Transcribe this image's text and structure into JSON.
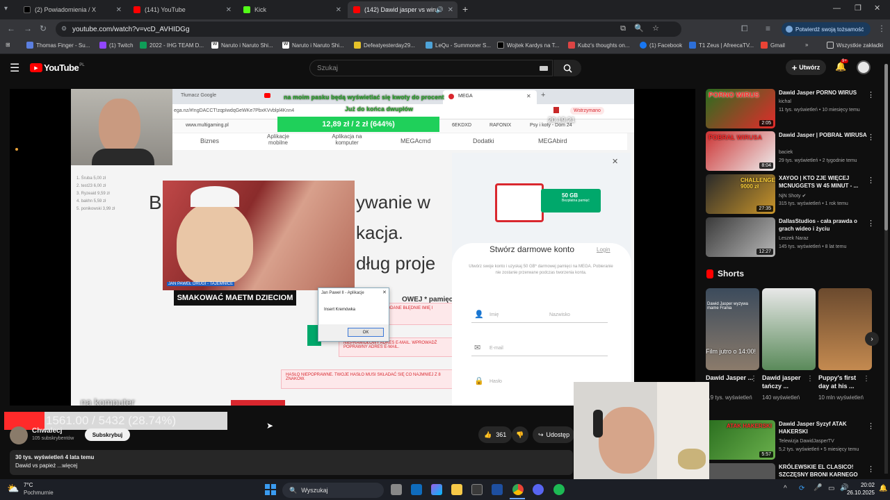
{
  "tabs": [
    {
      "label": "(2) Powiadomienia / X",
      "icon": "x-logo-icon"
    },
    {
      "label": "(141) YouTube",
      "icon": "youtube-icon"
    },
    {
      "label": "Kick",
      "icon": "kick-icon"
    },
    {
      "label": "(142) Dawid jasper vs wiru",
      "icon": "youtube-icon"
    }
  ],
  "address": {
    "url": "youtube.com/watch?v=vcD_AVHIDGg",
    "identity_button": "Potwierdź swoją tożsamość"
  },
  "bookmarks": [
    "Thomas Finger - Su...",
    "(1) Twitch",
    "2022 - IHG TEAM D...",
    "Naruto i Naruto Shi...",
    "Naruto i Naruto Shi...",
    "Defeatyesterday29...",
    "LeQu - Summoner S...",
    "Wojtek Kardys na T...",
    "Kubz's thoughts on...",
    "(1) Facebook",
    "T1 Zeus | AfreecaTV...",
    "Gmail",
    "Wszystkie zakładki"
  ],
  "yt": {
    "logo": "YouTube",
    "logo_region": "PL",
    "search_placeholder": "Szukaj",
    "create_label": "Utwórz",
    "notif_count": "9+"
  },
  "video_overlay": {
    "mega_tab": "MEGA",
    "google_tab": "Tłumacz Google",
    "mega_url": "ega.nz/#!ngDACCT!zqpIwdqGeWKe7PbxKVvblpl4Knn4",
    "donation_banner": "12,89 zł / 2 zł (644%)",
    "stream_text_top": "na moim pasku będą wyświetlać się kwoty do procent",
    "stream_text_top2": "Już do końca dwupłów",
    "bookmark_site": "www.multigaming.pl",
    "bookmark_right1": "6EKDXD",
    "bookmark_right2": "RAFONIX",
    "bookmark_right3": "Psy i koty - Dom 24",
    "timer": "20:19:21",
    "nav": [
      "Biznes",
      "Aplikacje mobilne",
      "Aplikacja na komputer",
      "MEGAcmd",
      "Dodatki",
      "MEGAbird"
    ],
    "headline_left": "B",
    "headline_right1": "ywanie w",
    "headline_right2": "kacja.",
    "headline_right3": "dług proje",
    "stats": [
      "1. Śruba 5,00 zł",
      "2. test23 6,00 zł",
      "3. Ryzeaid 9,59 zł",
      "4. bakhn 5,59 zł",
      "5. ponikowski 3,99 zł"
    ],
    "pope_caption": "JAN PAWEŁ DRUGI - TAJEMNICE",
    "pope_subtitle": "SMAKOWAĆ MAETM DZIECIOM",
    "dialog_title": "Jan Paweł II - Aplikacje",
    "dialog_text": "Insert Kremówka",
    "dialog_ok": "OK",
    "signup_title": "Stwórz darmowe konto",
    "signup_login": "Login",
    "signup_desc": "Utwórz swoje konto i uzyskaj 50 GB* darmowej pamięci na MEGA. Pobieranie nie zostanie przerwane podczas tworzenia konta.",
    "storage_badge": "50 GB",
    "storage_sub": "Bezpłatna pamięć",
    "field_name": "Imię",
    "field_surname": "Nazwisko",
    "field_email": "E-mail",
    "field_password": "Hasło",
    "err1": "WPROWADZONO PODANE BŁĘDNIE IMIĘ I NAZWISKO.",
    "err2": "NIEPRAWIDŁOWY ADRES E-MAIL. WPROWADŹ POPRAWNY ADRES E-MAIL.",
    "err3": "HASŁO NIEPOPRAWNE. TWOJE HASŁO MUSI SKŁADAĆ SIĘ CO NAJMNIEJ Z 8 ZNAKÓW.",
    "free_storage_label": "OWEJ * pamięci n",
    "caption_bottom": "na komputer"
  },
  "progress": {
    "text": "1561.00 / 5432 (28.74%)",
    "fraction": 0.2874
  },
  "channel": {
    "name": "Chwalecj",
    "subs": "105 subskrybentów",
    "subscribe": "Subskrybuj"
  },
  "actions": {
    "likes": "361",
    "share": "Udostęp"
  },
  "description": {
    "stats": "30 tys. wyświetleń  4 lata temu",
    "title": "Dawid vs papież  ...więcej"
  },
  "recommendations": [
    {
      "title": "Dawid Jasper PORNO WIRUS",
      "channel": "kichal",
      "meta": "11 tys. wyświetleń • 10 miesięcy temu",
      "duration": "2:05",
      "thumb_text": "PORNO WIRUS",
      "verified": false
    },
    {
      "title": "Dawid Jasper | POBRAŁ WIRUSA",
      "channel": "baciek",
      "meta": "29 tys. wyświetleń • 2 tygodnie temu",
      "duration": "8:04",
      "thumb_text": "POBRAŁ WIRUSA",
      "verified": false
    },
    {
      "title": "XAYOO | KTO ZJE WIĘCEJ MCNUGGETS W 45 MINUT - ...",
      "channel": "NjN Shoty",
      "meta": "315 tys. wyświetleń • 1 rok temu",
      "duration": "27:35",
      "thumb_text": "CHALLENGE 9000 zł",
      "verified": true
    },
    {
      "title": "DallasStudios - cała prawda o grach wideo i życiu",
      "channel": "Leszek Naraz",
      "meta": "145 tys. wyświetleń • 8 lat temu",
      "duration": "12:27",
      "thumb_text": "",
      "verified": false
    }
  ],
  "shorts_heading": "Shorts",
  "shorts": [
    {
      "title": "Dawid Jasper ...",
      "meta": "1,9 tys. wyświetleń",
      "overlay": "Film jutro o 14:00!",
      "top": "Dawid Jasper wyzywa mame Frania"
    },
    {
      "title": "Dawid jasper tańczy ...",
      "meta": "140 wyświetleń",
      "overlay": "",
      "top": ""
    },
    {
      "title": "Puppy's first day at his ...",
      "meta": "10 mln wyświetleń",
      "overlay": "",
      "top": ""
    }
  ],
  "rec_after": [
    {
      "title": "Dawid Jasper Syzyf ATAK HAKERSKI",
      "channel": "Telewizja DawidJasperTV",
      "meta": "5,2 tys. wyświetleń • 5 miesięcy temu",
      "duration": "5:57",
      "thumb_text": "ATAK HAKERSKI"
    },
    {
      "title": "KRÓLEWSKIE EL CLASICO! SZCZĘSNY BRONI KARNEGO",
      "channel": "",
      "meta": "",
      "duration": "",
      "thumb_text": ""
    }
  ],
  "taskbar": {
    "weather_temp": "7°C",
    "weather_desc": "Pochmurnie",
    "search": "Wyszukaj",
    "time": "20:02",
    "date": "26.10.2025"
  },
  "colors": {
    "yt_red": "#ff0000",
    "bg": "#0f0f0f",
    "mega_red": "#d9272e",
    "mega_green": "#00a86b"
  }
}
